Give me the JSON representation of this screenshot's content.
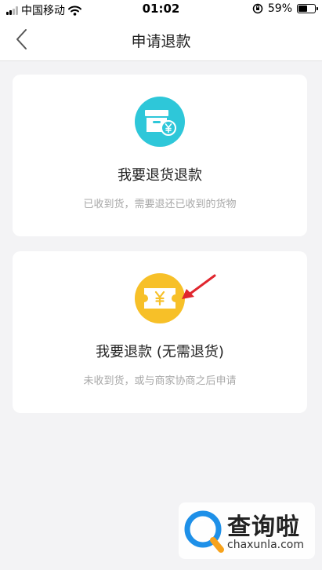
{
  "status_bar": {
    "carrier": "中国移动",
    "time": "01:02",
    "battery_percent": "59%",
    "battery_level": 0.59
  },
  "nav": {
    "title": "申请退款",
    "back_icon": "chevron-left-icon"
  },
  "options": [
    {
      "title": "我要退货退款",
      "subtitle": "已收到货，需要退还已收到的货物",
      "icon": "box-yen-icon",
      "color": "#2ec7d9"
    },
    {
      "title": "我要退款 (无需退货)",
      "subtitle": "未收到货，或与商家协商之后申请",
      "icon": "ticket-yen-icon",
      "color": "#f7c028"
    }
  ],
  "watermark": {
    "text": "查询啦",
    "url": "chaxunla.com"
  }
}
